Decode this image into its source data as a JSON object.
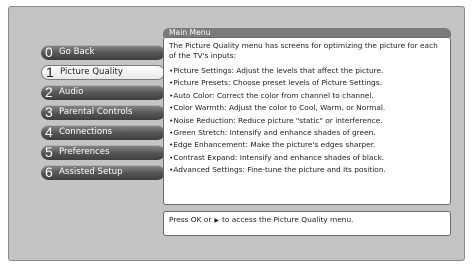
{
  "menu": {
    "title": "Main Menu",
    "items": [
      {
        "num": "0",
        "label": "Go Back",
        "selected": false
      },
      {
        "num": "1",
        "label": "Picture Quality",
        "selected": true
      },
      {
        "num": "2",
        "label": "Audio",
        "selected": false
      },
      {
        "num": "3",
        "label": "Parental Controls",
        "selected": false
      },
      {
        "num": "4",
        "label": "Connections",
        "selected": false
      },
      {
        "num": "5",
        "label": "Preferences",
        "selected": false
      },
      {
        "num": "6",
        "label": "Assisted Setup",
        "selected": false
      }
    ]
  },
  "info": {
    "intro": "The Picture Quality menu has screens for optimizing the picture for each of the TV's inputs:",
    "bullets": [
      "•Picture Settings: Adjust the levels that affect the picture.",
      "•Picture Presets: Choose preset levels of Picture Settings.",
      "•Auto Color: Correct the color from channel to channel.",
      "•Color Warmth: Adjust the color to Cool, Warm, or Normal.",
      "•Noise Reduction: Reduce picture \"static\" or interference.",
      "•Green Stretch: Intensify and enhance shades of green.",
      "•Edge Enhancement: Make the picture's edges sharper.",
      "•Contrast Expand: Intensify and enhance shades of black.",
      "•Advanced Settings: Fine-tune the picture and its position."
    ]
  },
  "hint": {
    "before": "Press OK or",
    "arrow_icon": "right-triangle-icon",
    "after": "to access the Picture Quality menu."
  }
}
